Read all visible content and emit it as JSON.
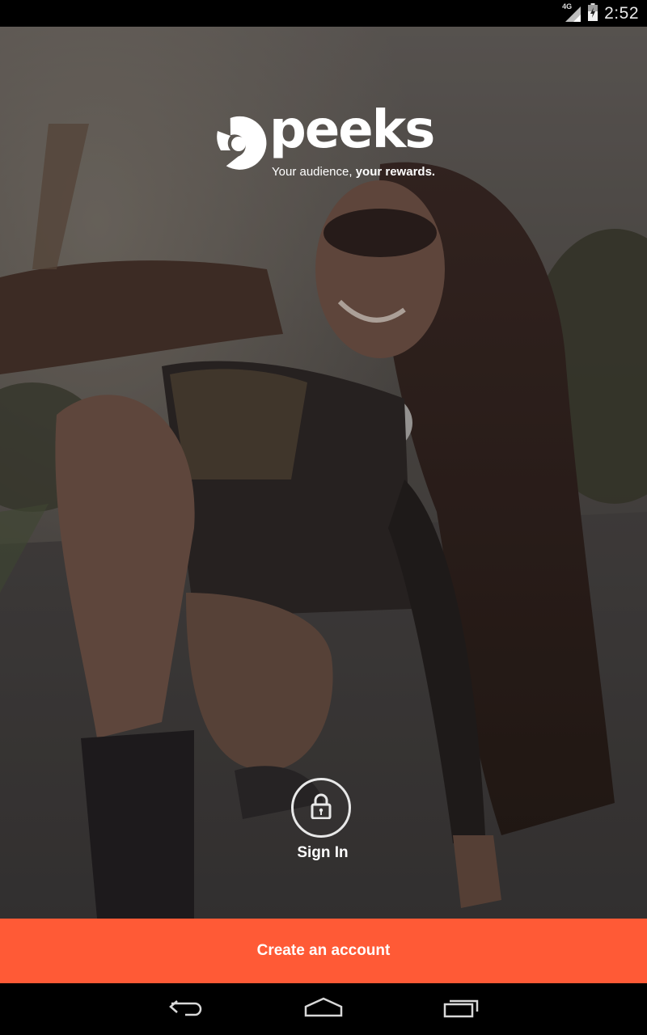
{
  "status_bar": {
    "time": "2:52",
    "network_type": "4G",
    "icons": [
      "signal-icon",
      "battery-icon"
    ]
  },
  "brand": {
    "name": "peeks",
    "tagline_regular": "Your audience, ",
    "tagline_bold": "your rewards.",
    "logo_icon": "peeks-logo-icon"
  },
  "signin": {
    "icon": "lock-icon",
    "label": "Sign In"
  },
  "create_account": {
    "label": "Create an account"
  },
  "nav": {
    "icons": [
      "back-icon",
      "home-icon",
      "recent-apps-icon"
    ]
  },
  "colors": {
    "accent": "#ff5a36",
    "status_bar": "#000000",
    "nav_bar": "#000000",
    "text": "#ffffff"
  }
}
